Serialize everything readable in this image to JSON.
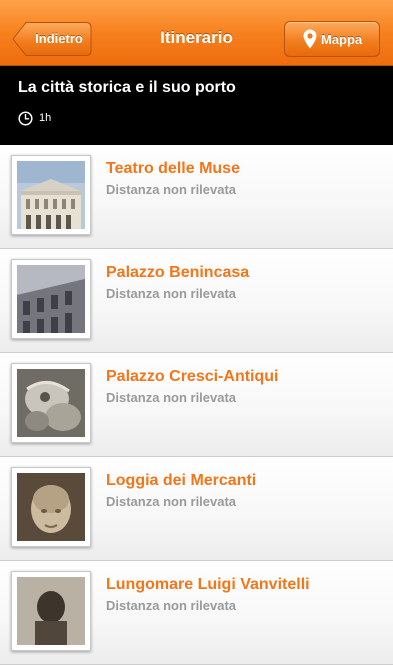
{
  "navbar": {
    "back_label": "Indietro",
    "title": "Itinerario",
    "map_label": "Mappa",
    "accent_color": "#f7811e",
    "back_icon": "chevron-left-shape",
    "map_icon": "map-pin-icon"
  },
  "route": {
    "title": "La città storica e il suo porto",
    "duration": "1h",
    "duration_icon": "clock-icon"
  },
  "poi_list": {
    "items": [
      {
        "name": "Teatro delle Muse",
        "distance": "Distanza non rilevata",
        "thumbnail": "theatre-building-photo"
      },
      {
        "name": "Palazzo Benincasa",
        "distance": "Distanza non rilevata",
        "thumbnail": "palazzo-facade-photo"
      },
      {
        "name": "Palazzo Cresci-Antiqui",
        "distance": "Distanza non rilevata",
        "thumbnail": "stone-relief-photo"
      },
      {
        "name": "Loggia dei Mercanti",
        "distance": "Distanza non rilevata",
        "thumbnail": "sculpted-head-photo"
      },
      {
        "name": "Lungomare Luigi Vanvitelli",
        "distance": "Distanza non rilevata",
        "thumbnail": "statue-photo"
      }
    ],
    "name_color": "#f2761a",
    "distance_color": "#9a9a9a"
  }
}
